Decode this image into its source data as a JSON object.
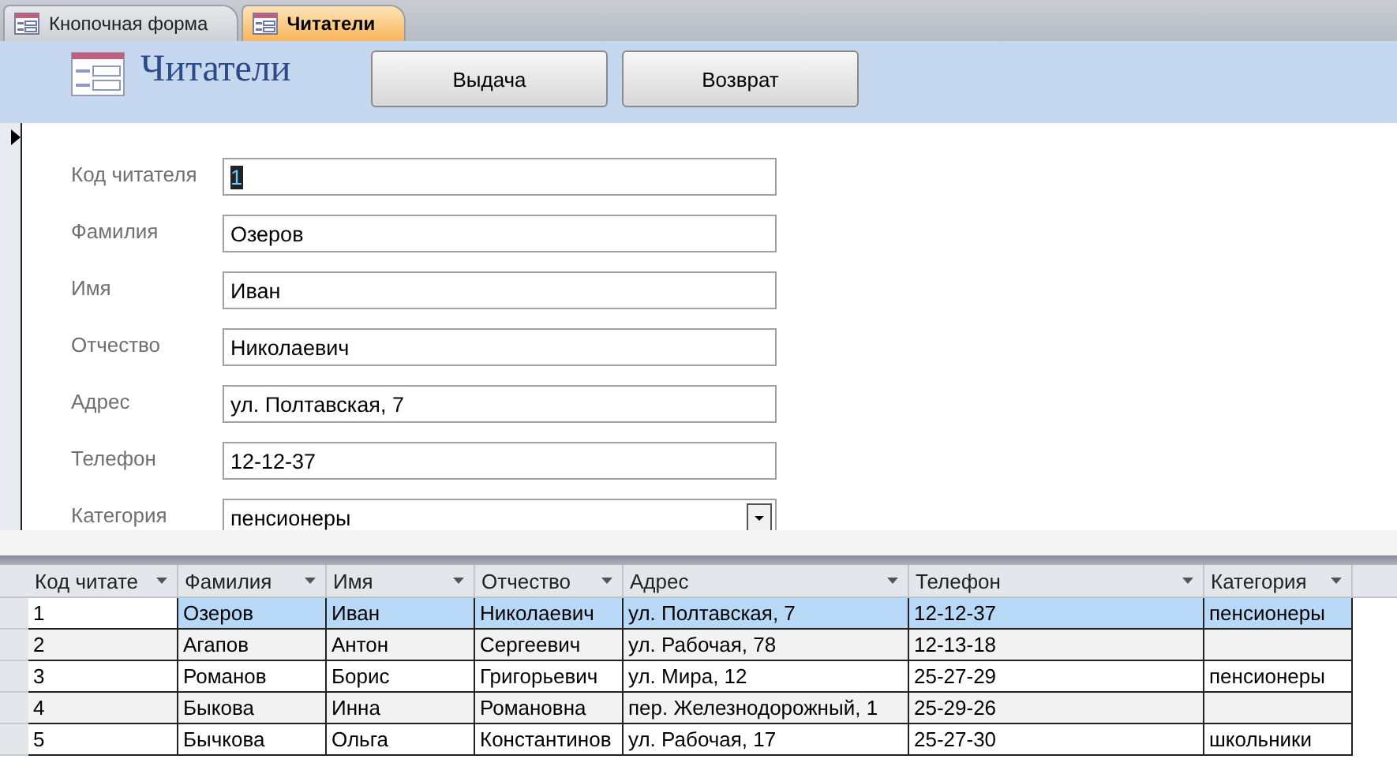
{
  "tabs": [
    {
      "label": "Кнопочная форма",
      "selected": false
    },
    {
      "label": "Читатели",
      "selected": true
    }
  ],
  "header": {
    "title": "Читатели",
    "buttons": [
      "Выдача",
      "Возврат"
    ]
  },
  "form": {
    "fields": [
      {
        "label": "Код читателя",
        "value": "1",
        "kind": "text",
        "selected": true
      },
      {
        "label": "Фамилия",
        "value": "Озеров",
        "kind": "text",
        "selected": false
      },
      {
        "label": "Имя",
        "value": "Иван",
        "kind": "text",
        "selected": false
      },
      {
        "label": "Отчество",
        "value": "Николаевич",
        "kind": "text",
        "selected": false
      },
      {
        "label": "Адрес",
        "value": "ул. Полтавская, 7",
        "kind": "text",
        "selected": false
      },
      {
        "label": "Телефон",
        "value": "12-12-37",
        "kind": "text",
        "selected": false
      },
      {
        "label": "Категория",
        "value": "пенсионеры",
        "kind": "combo",
        "selected": false
      }
    ]
  },
  "table": {
    "columns": [
      "Код читате",
      "Фамилия",
      "Имя",
      "Отчество",
      "Адрес",
      "Телефон",
      "Категория"
    ],
    "rows": [
      {
        "cells": [
          "1",
          "Озеров",
          "Иван",
          "Николаевич",
          "ул. Полтавская, 7",
          "12-12-37",
          "пенсионеры"
        ],
        "selected": true
      },
      {
        "cells": [
          "2",
          "Агапов",
          "Антон",
          "Сергеевич",
          "ул. Рабочая, 78",
          "12-13-18",
          ""
        ],
        "selected": false
      },
      {
        "cells": [
          "3",
          "Романов",
          "Борис",
          "Григорьевич",
          "ул. Мира, 12",
          "25-27-29",
          "пенсионеры"
        ],
        "selected": false
      },
      {
        "cells": [
          "4",
          "Быкова",
          "Инна",
          "Романовна",
          "пер. Железнодорожный, 1",
          "25-29-26",
          ""
        ],
        "selected": false
      },
      {
        "cells": [
          "5",
          "Бычкова",
          "Ольга",
          "Константинов",
          "ул. Рабочая, 17",
          "25-27-30",
          "школьники"
        ],
        "selected": false
      }
    ]
  }
}
